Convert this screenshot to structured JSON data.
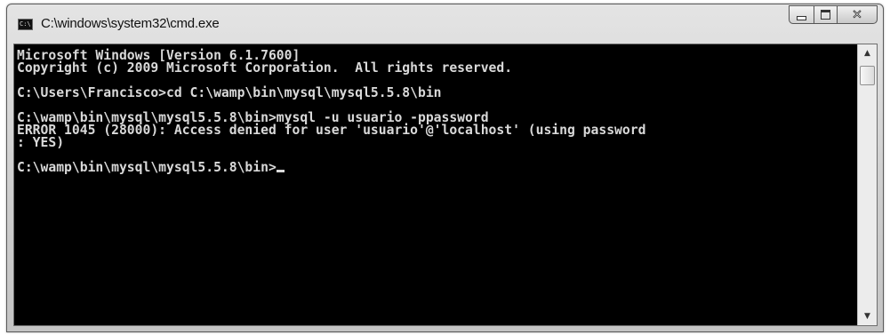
{
  "window": {
    "title": "C:\\windows\\system32\\cmd.exe",
    "icon_text": "C:\\"
  },
  "console": {
    "lines": [
      "Microsoft Windows [Version 6.1.7600]",
      "Copyright (c) 2009 Microsoft Corporation.  All rights reserved.",
      "",
      "C:\\Users\\Francisco>cd C:\\wamp\\bin\\mysql\\mysql5.5.8\\bin",
      "",
      "C:\\wamp\\bin\\mysql\\mysql5.5.8\\bin>mysql -u usuario -ppassword",
      "ERROR 1045 (28000): Access denied for user 'usuario'@'localhost' (using password",
      ": YES)",
      "",
      "C:\\wamp\\bin\\mysql\\mysql5.5.8\\bin>"
    ],
    "foreground": "#d9d9d9",
    "background": "#000000"
  },
  "icons": {
    "app": "console-app-icon",
    "minimize": "minimize-icon",
    "maximize": "maximize-icon",
    "close": "close-icon",
    "scroll_up": "arrow-up-icon",
    "scroll_down": "arrow-down-icon"
  }
}
